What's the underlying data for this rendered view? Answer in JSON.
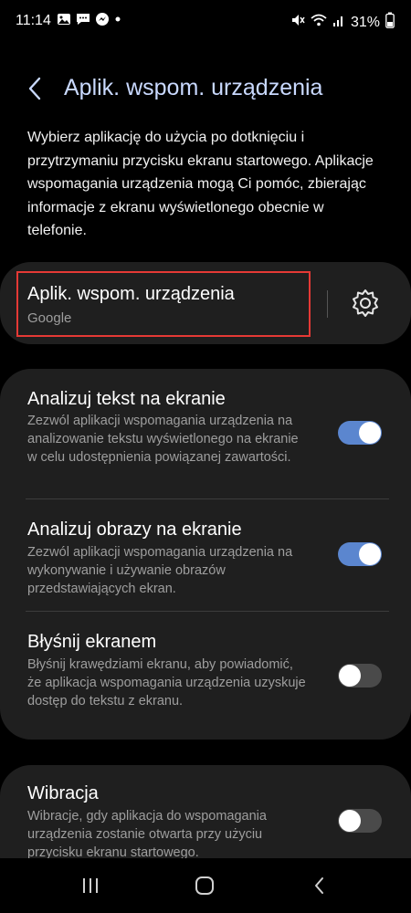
{
  "status_bar": {
    "time": "11:14",
    "battery_percent": "31%",
    "icons_left": [
      "gallery-icon",
      "messages-icon",
      "messenger-icon",
      "dot-icon"
    ],
    "icons_right": [
      "mute-icon",
      "wifi-icon",
      "signal-icon",
      "battery-icon"
    ]
  },
  "header": {
    "title": "Aplik. wspom. urządzenia"
  },
  "intro_text": "Wybierz aplikację do użycia po dotknięciu i przytrzymaniu przycisku ekranu startowego. Aplikacje wspomagania urządzenia mogą Ci pomóc, zbierając informacje z ekranu wyświetlonego obecnie w telefonie.",
  "assist_app": {
    "title": "Aplik. wspom. urządzenia",
    "value": "Google"
  },
  "settings": [
    {
      "title": "Analizuj tekst na ekranie",
      "description": "Zezwól aplikacji wspomagania urządzenia na analizowanie tekstu wyświetlonego na ekranie w celu udostępnienia powiązanej zawartości.",
      "enabled": true
    },
    {
      "title": "Analizuj obrazy na ekranie",
      "description": "Zezwól aplikacji wspomagania urządzenia na wykonywanie i używanie obrazów przedstawiających ekran.",
      "enabled": true
    },
    {
      "title": "Błyśnij ekranem",
      "description": "Błyśnij krawędziami ekranu, aby powiadomić, że aplikacja wspomagania urządzenia uzyskuje dostęp do tekstu z ekranu.",
      "enabled": false
    },
    {
      "title": "Wibracja",
      "description": "Wibracje, gdy aplikacja do wspomagania urządzenia zostanie otwarta przy użyciu przycisku ekranu startowego.",
      "enabled": false
    }
  ],
  "colors": {
    "background": "#000000",
    "card": "#1f1f1f",
    "title_accent": "#c9d9ff",
    "toggle_on": "#5b86cf",
    "toggle_off": "#4a4a4a",
    "highlight_box": "#e53935"
  },
  "nav_bar": {
    "buttons": [
      "recent-apps-icon",
      "home-icon",
      "back-icon"
    ]
  }
}
